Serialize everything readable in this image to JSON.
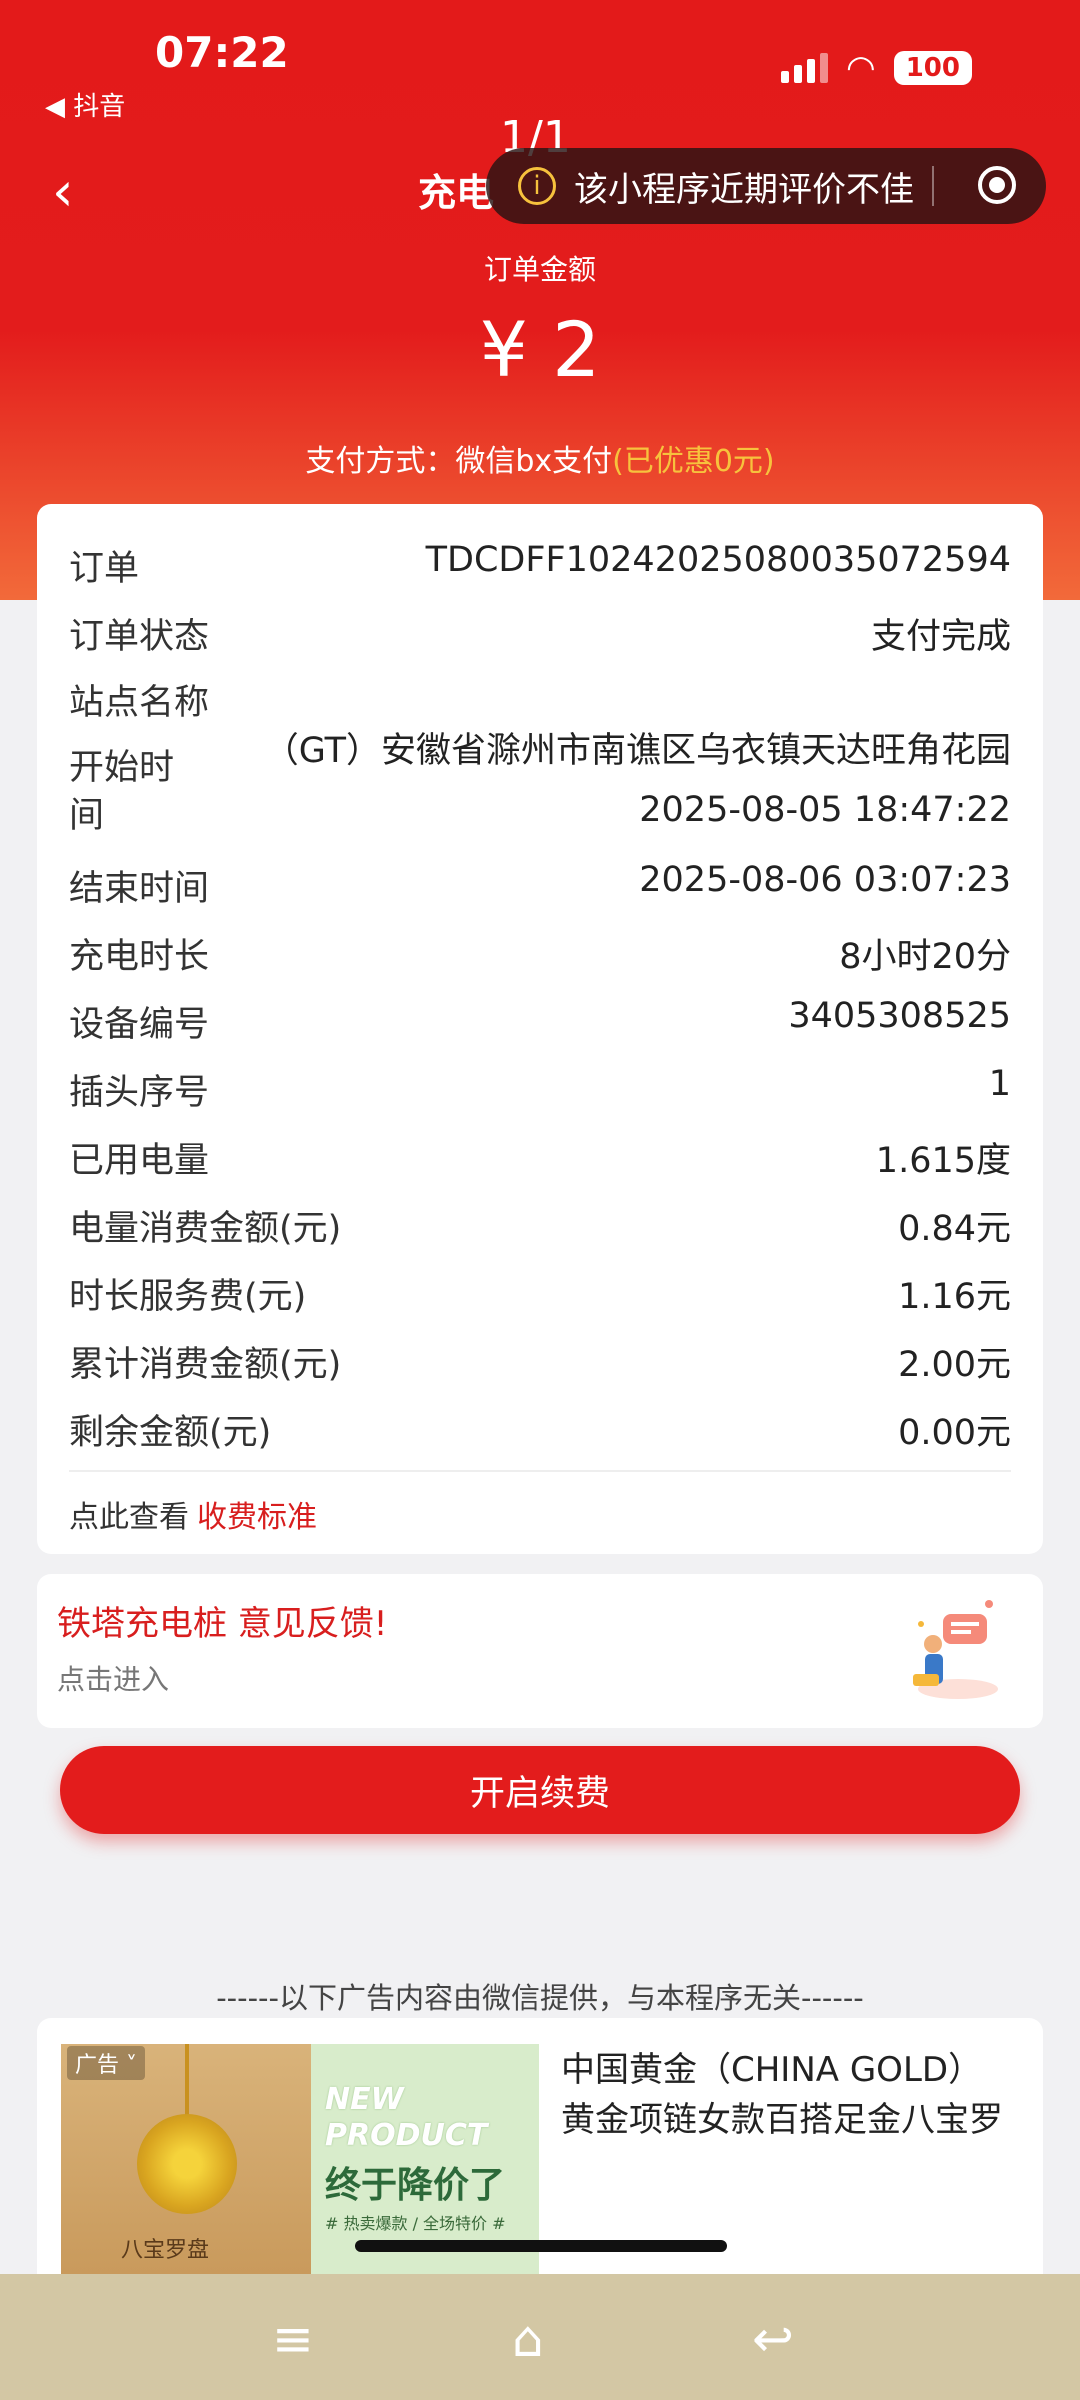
{
  "status_bar": {
    "time": "07:22",
    "back_app": "◀ 抖音",
    "battery": "100"
  },
  "page_indicator": "1/1",
  "title": "充电",
  "warning": "该小程序近期评价不佳",
  "amount_label": "订单金额",
  "amount": "¥ 2",
  "pay_method_label": "支付方式：微信bx支付",
  "pay_method_discount": "(已优惠0元)",
  "order": {
    "rows": [
      {
        "label": "订单",
        "value": "TDCDFF10242025080035072594"
      },
      {
        "label": "订单状态",
        "value": "支付完成"
      }
    ],
    "station_label": "站点名称",
    "station_value": "（GT）安徽省滁州市南谯区乌衣镇天达旺角花园",
    "start_label": "开始时间",
    "start_value": "2025-08-05 18:47:22",
    "rows2": [
      {
        "label": "结束时间",
        "value": "2025-08-06 03:07:23"
      },
      {
        "label": "充电时长",
        "value": "8小时20分"
      },
      {
        "label": "设备编号",
        "value": "3405308525"
      },
      {
        "label": "插头序号",
        "value": "1"
      },
      {
        "label": "已用电量",
        "value": "1.615度"
      },
      {
        "label": "电量消费金额(元)",
        "value": "0.84元"
      },
      {
        "label": "时长服务费(元)",
        "value": "1.16元"
      },
      {
        "label": "累计消费金额(元)",
        "value": "2.00元"
      },
      {
        "label": "剩余金额(元)",
        "value": "0.00元"
      }
    ],
    "tariff_prefix": "点此查看",
    "tariff_link": "收费标准"
  },
  "feedback": {
    "title": "铁塔充电桩 意见反馈!",
    "subtitle": "点击进入"
  },
  "renew_button": "开启续费",
  "ad_notice": "------以下广告内容由微信提供，与本程序无关------",
  "ad": {
    "tag": "广告 ˅",
    "new_text": "NEW PRODUCT",
    "price_text": "终于降价了",
    "small_text": "# 热卖爆款 / 全场特价 #",
    "caption": "八宝罗盘",
    "title_line1": "中国黄金（CHINA GOLD）",
    "title_line2": "黄金项链女款百搭足金八宝罗"
  },
  "nav": {
    "menu": "≡",
    "home": "⌂",
    "back": "↩"
  },
  "colors": {
    "brand_red": "#e31c1c",
    "discount_yellow": "#f7c23d"
  }
}
